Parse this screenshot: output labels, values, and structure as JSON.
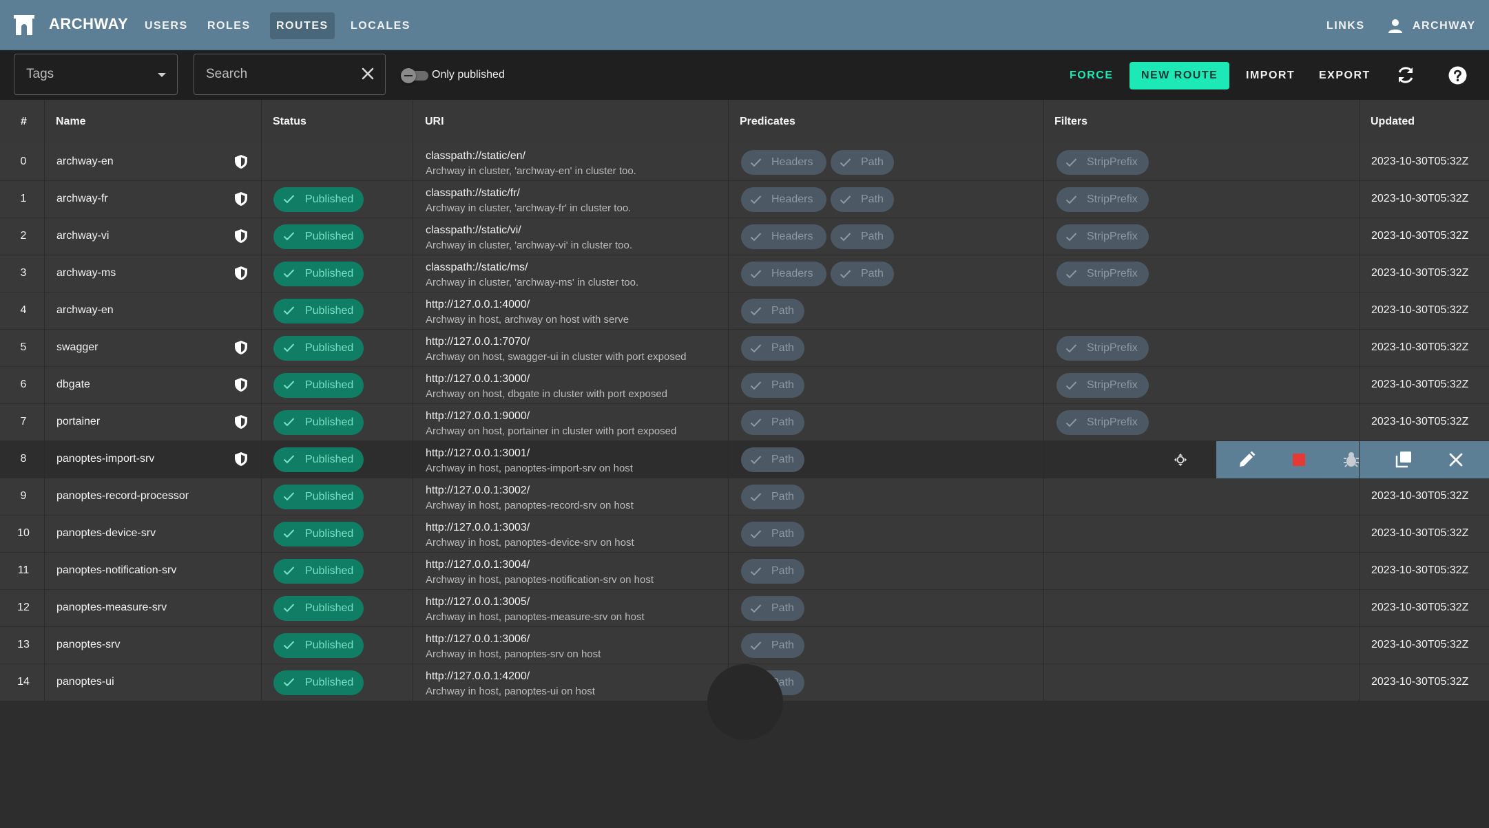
{
  "appbar": {
    "brand": "ARCHWAY",
    "nav": [
      "USERS",
      "ROLES",
      "ROUTES",
      "LOCALES"
    ],
    "active_nav": "ROUTES",
    "links_label": "LINKS",
    "user_label": "ARCHWAY",
    "color": "#5d7f96"
  },
  "toolbar": {
    "tags_placeholder": "Tags",
    "search_placeholder": "Search",
    "only_published_label": "Only published",
    "only_published_on": false,
    "force_label": "FORCE",
    "new_route_label": "NEW ROUTE",
    "import_label": "IMPORT",
    "export_label": "EXPORT",
    "accent": "#1de9b6"
  },
  "table": {
    "headers": [
      "#",
      "Name",
      "Status",
      "URI",
      "Predicates",
      "Filters",
      "Updated"
    ],
    "rows": [
      {
        "idx": "0",
        "name": "archway-en",
        "secured": true,
        "status": "",
        "uri": "classpath://static/en/",
        "desc": "Archway in cluster, 'archway-en' in cluster too.",
        "predicates": [
          "Headers",
          "Path"
        ],
        "filters": [
          "StripPrefix"
        ],
        "updated": "2023-10-30T05:32Z"
      },
      {
        "idx": "1",
        "name": "archway-fr",
        "secured": true,
        "status": "Published",
        "uri": "classpath://static/fr/",
        "desc": "Archway in cluster, 'archway-fr' in cluster too.",
        "predicates": [
          "Headers",
          "Path"
        ],
        "filters": [
          "StripPrefix"
        ],
        "updated": "2023-10-30T05:32Z"
      },
      {
        "idx": "2",
        "name": "archway-vi",
        "secured": true,
        "status": "Published",
        "uri": "classpath://static/vi/",
        "desc": "Archway in cluster, 'archway-vi' in cluster too.",
        "predicates": [
          "Headers",
          "Path"
        ],
        "filters": [
          "StripPrefix"
        ],
        "updated": "2023-10-30T05:32Z"
      },
      {
        "idx": "3",
        "name": "archway-ms",
        "secured": true,
        "status": "Published",
        "uri": "classpath://static/ms/",
        "desc": "Archway in cluster, 'archway-ms' in cluster too.",
        "predicates": [
          "Headers",
          "Path"
        ],
        "filters": [
          "StripPrefix"
        ],
        "updated": "2023-10-30T05:32Z"
      },
      {
        "idx": "4",
        "name": "archway-en",
        "secured": false,
        "status": "Published",
        "uri": "http://127.0.0.1:4000/",
        "desc": "Archway in host, archway on host with serve",
        "predicates": [
          "Path"
        ],
        "filters": [],
        "updated": "2023-10-30T05:32Z"
      },
      {
        "idx": "5",
        "name": "swagger",
        "secured": true,
        "status": "Published",
        "uri": "http://127.0.0.1:7070/",
        "desc": "Archway on host, swagger-ui in cluster with port exposed",
        "predicates": [
          "Path"
        ],
        "filters": [
          "StripPrefix"
        ],
        "updated": "2023-10-30T05:32Z"
      },
      {
        "idx": "6",
        "name": "dbgate",
        "secured": true,
        "status": "Published",
        "uri": "http://127.0.0.1:3000/",
        "desc": "Archway on host, dbgate in cluster with port exposed",
        "predicates": [
          "Path"
        ],
        "filters": [
          "StripPrefix"
        ],
        "updated": "2023-10-30T05:32Z"
      },
      {
        "idx": "7",
        "name": "portainer",
        "secured": true,
        "status": "Published",
        "uri": "http://127.0.0.1:9000/",
        "desc": "Archway on host, portainer in cluster with port exposed",
        "predicates": [
          "Path"
        ],
        "filters": [
          "StripPrefix"
        ],
        "updated": "2023-10-30T05:32Z"
      },
      {
        "idx": "8",
        "name": "panoptes-import-srv",
        "secured": true,
        "status": "Published",
        "uri": "http://127.0.0.1:3001/",
        "desc": "Archway in host, panoptes-import-srv on host",
        "predicates": [
          "Path"
        ],
        "filters": [],
        "updated": "",
        "hovered": true
      },
      {
        "idx": "9",
        "name": "panoptes-record-processor",
        "secured": false,
        "status": "Published",
        "uri": "http://127.0.0.1:3002/",
        "desc": "Archway in host, panoptes-record-srv on host",
        "predicates": [
          "Path"
        ],
        "filters": [],
        "updated": "2023-10-30T05:32Z"
      },
      {
        "idx": "10",
        "name": "panoptes-device-srv",
        "secured": false,
        "status": "Published",
        "uri": "http://127.0.0.1:3003/",
        "desc": "Archway in host, panoptes-device-srv on host",
        "predicates": [
          "Path"
        ],
        "filters": [],
        "updated": "2023-10-30T05:32Z"
      },
      {
        "idx": "11",
        "name": "panoptes-notification-srv",
        "secured": false,
        "status": "Published",
        "uri": "http://127.0.0.1:3004/",
        "desc": "Archway in host, panoptes-notification-srv on host",
        "predicates": [
          "Path"
        ],
        "filters": [],
        "updated": "2023-10-30T05:32Z"
      },
      {
        "idx": "12",
        "name": "panoptes-measure-srv",
        "secured": false,
        "status": "Published",
        "uri": "http://127.0.0.1:3005/",
        "desc": "Archway in host, panoptes-measure-srv on host",
        "predicates": [
          "Path"
        ],
        "filters": [],
        "updated": "2023-10-30T05:32Z"
      },
      {
        "idx": "13",
        "name": "panoptes-srv",
        "secured": false,
        "status": "Published",
        "uri": "http://127.0.0.1:3006/",
        "desc": "Archway in host, panoptes-srv on host",
        "predicates": [
          "Path"
        ],
        "filters": [],
        "updated": "2023-10-30T05:32Z"
      },
      {
        "idx": "14",
        "name": "panoptes-ui",
        "secured": false,
        "status": "Published",
        "uri": "http://127.0.0.1:4200/",
        "desc": "Archway in host, panoptes-ui on host",
        "predicates": [
          "Path"
        ],
        "filters": [],
        "updated": "2023-10-30T05:32Z"
      }
    ],
    "row_actions": [
      "edit-icon",
      "stop-icon",
      "bug-icon",
      "copy-icon",
      "close-icon"
    ],
    "published_color": "#0f7e65",
    "chip_color": "#4c5964"
  }
}
